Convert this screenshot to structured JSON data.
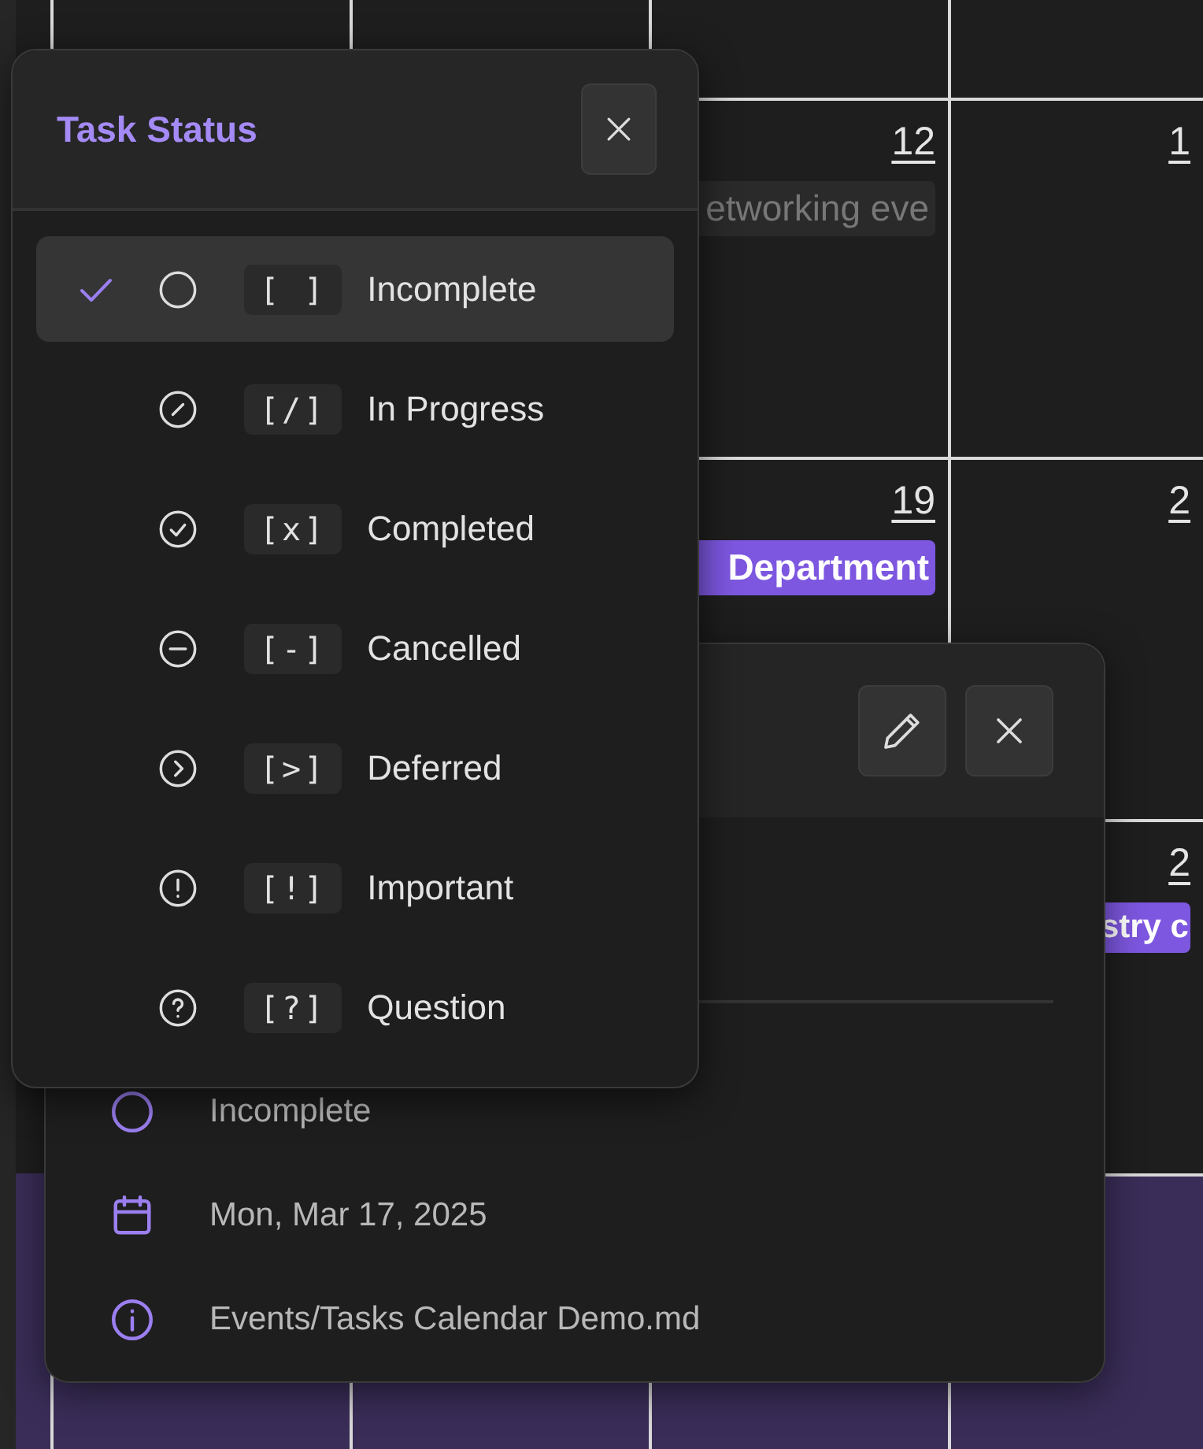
{
  "calendar": {
    "weeks": [
      {
        "highlighted": false
      },
      {
        "highlighted": false,
        "days": [
          {
            "date": "12",
            "events": [
              {
                "title": "etworking eve",
                "kind": "faded"
              }
            ]
          },
          {
            "date": "1"
          }
        ]
      },
      {
        "highlighted": false,
        "days": [
          {
            "date": "19",
            "events": [
              {
                "title": "Department",
                "kind": "filled"
              }
            ]
          },
          {
            "date": "2"
          }
        ]
      },
      {
        "highlighted": false,
        "days": [
          {
            "date": "2",
            "events": [
              {
                "title": "stry c",
                "kind": "filled"
              }
            ]
          }
        ]
      },
      {
        "highlighted": true
      }
    ]
  },
  "event_popup": {
    "buttons": [
      {
        "kind": "edit"
      },
      {
        "kind": "close"
      }
    ],
    "details": [
      {
        "kind": "status",
        "text": "Incomplete"
      },
      {
        "kind": "date",
        "text": "Mon, Mar 17, 2025"
      },
      {
        "kind": "file",
        "text": "Events/Tasks Calendar Demo.md"
      }
    ]
  },
  "task_status_menu": {
    "title": "Task Status",
    "items": [
      {
        "kind": "incomplete",
        "code": "[ ]",
        "label": "Incomplete",
        "selected": true
      },
      {
        "kind": "in-progress",
        "code": "[/]",
        "label": "In Progress",
        "selected": false
      },
      {
        "kind": "completed",
        "code": "[x]",
        "label": "Completed",
        "selected": false
      },
      {
        "kind": "cancelled",
        "code": "[-]",
        "label": "Cancelled",
        "selected": false
      },
      {
        "kind": "deferred",
        "code": "[>]",
        "label": "Deferred",
        "selected": false
      },
      {
        "kind": "important",
        "code": "[!]",
        "label": "Important",
        "selected": false
      },
      {
        "kind": "question",
        "code": "[?]",
        "label": "Question",
        "selected": false
      }
    ]
  }
}
